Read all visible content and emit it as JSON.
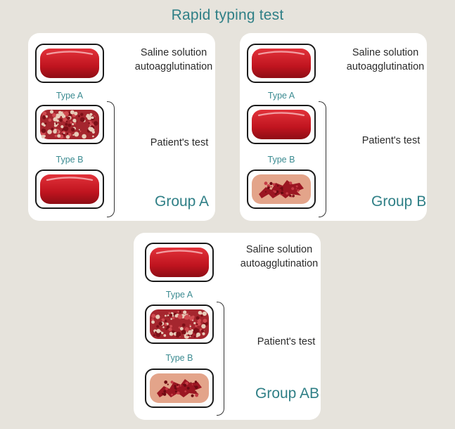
{
  "title": "Rapid typing test",
  "labels": {
    "saline": "Saline solution",
    "autoagglutination": "autoagglutination",
    "type_a": "Type A",
    "type_b": "Type B",
    "patients_test": "Patient's test"
  },
  "panels": [
    {
      "group": "Group A",
      "wells": [
        "smooth",
        "agglutinated-granular",
        "smooth"
      ]
    },
    {
      "group": "Group B",
      "wells": [
        "smooth",
        "smooth",
        "agglutinated-clumped"
      ]
    },
    {
      "group": "Group AB",
      "wells": [
        "smooth",
        "agglutinated-granular",
        "agglutinated-clumped"
      ]
    }
  ],
  "colors": {
    "blood_red": "#c0141f",
    "plasma_pink": "#e3a48a",
    "accent_teal": "#2f7f86"
  },
  "icons": [
    "smooth-blood-drop-icon",
    "granular-agglutination-icon",
    "clumped-agglutination-icon"
  ]
}
